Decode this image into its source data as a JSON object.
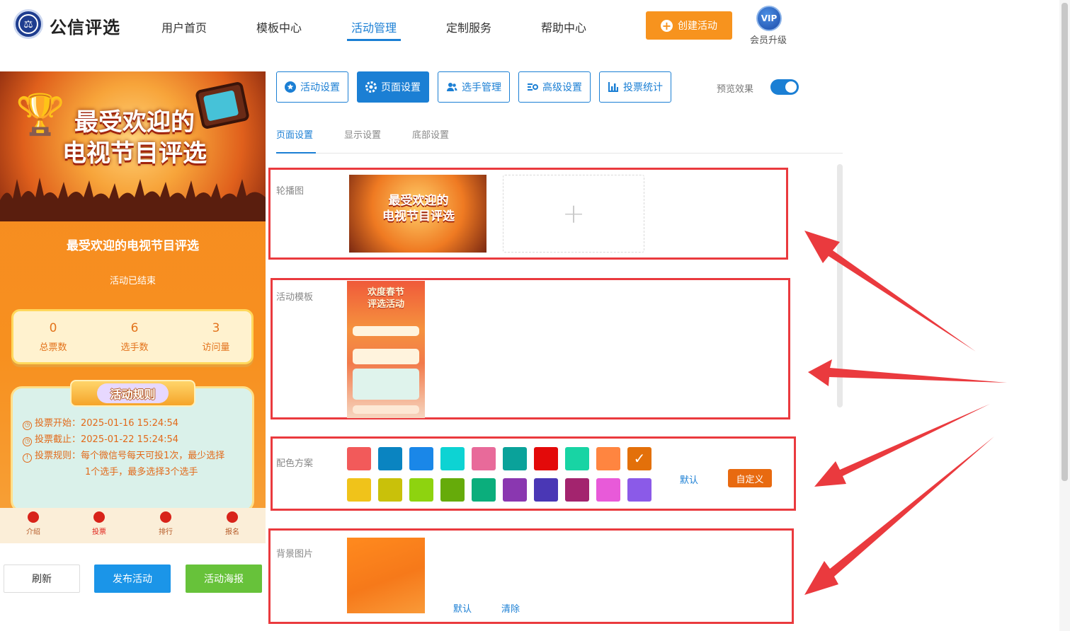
{
  "header": {
    "brand": "公信评选",
    "nav": [
      "用户首页",
      "模板中心",
      "活动管理",
      "定制服务",
      "帮助中心"
    ],
    "active_nav": "活动管理",
    "create_button": "创建活动",
    "vip_badge": "VIP",
    "vip_label": "会员升级"
  },
  "preview": {
    "banner_title_line1": "最受欢迎的",
    "banner_title_line2": "电视节目评选",
    "title": "最受欢迎的电视节目评选",
    "status": "活动已结束",
    "stats": [
      {
        "value": "0",
        "label": "总票数"
      },
      {
        "value": "6",
        "label": "选手数"
      },
      {
        "value": "3",
        "label": "访问量"
      }
    ],
    "rules_title": "活动规则",
    "rules": {
      "start": "投票开始：2025-01-16 15:24:54",
      "end": "投票截止：2025-01-22 15:24:54",
      "rule_line1": "投票规则：每个微信号每天可投1次，最少选择",
      "rule_line2": "1个选手，最多选择3个选手"
    },
    "tabbar": [
      "介绍",
      "投票",
      "排行",
      "报名"
    ],
    "active_tab": "投票"
  },
  "actions": {
    "refresh": "刷新",
    "publish": "发布活动",
    "poster": "活动海报"
  },
  "settings": {
    "tabs": [
      "活动设置",
      "页面设置",
      "选手管理",
      "高级设置",
      "投票统计"
    ],
    "active_tab": "页面设置",
    "preview_toggle_label": "预览效果",
    "preview_toggle_on": true,
    "subtabs": [
      "页面设置",
      "显示设置",
      "底部设置"
    ],
    "active_subtab": "页面设置",
    "carousel_label": "轮播图",
    "carousel_image_text_line1": "最受欢迎的",
    "carousel_image_text_line2": "电视节目评选",
    "upload_icon": "+",
    "template_label": "活动模板",
    "template_title_line1": "欢度春节",
    "template_title_line2": "评选活动",
    "color_label": "配色方案",
    "colors_row1": [
      "#f25a5a",
      "#0a84c1",
      "#1a87e8",
      "#0dd3d3",
      "#e86a9a",
      "#0aa29a",
      "#e30a0a",
      "#18d4a4",
      "#ff8540",
      "#e3700a"
    ],
    "colors_row2": [
      "#f0c31a",
      "#c9c10a",
      "#8ed30f",
      "#66ab0a",
      "#0bae7c",
      "#8a37b0",
      "#4a37b5",
      "#a3246e",
      "#e85ad9",
      "#8b5ae8"
    ],
    "selected_color": "#e3700a",
    "color_default": "默认",
    "color_custom": "自定义",
    "bg_label": "背景图片",
    "bg_default": "默认",
    "bg_clear": "清除"
  },
  "colors": {
    "accent": "#1b7fd4",
    "highlight_border": "#ea3a3e",
    "create": "#f7931e",
    "publish": "#1b95e8",
    "poster": "#67c23a"
  }
}
